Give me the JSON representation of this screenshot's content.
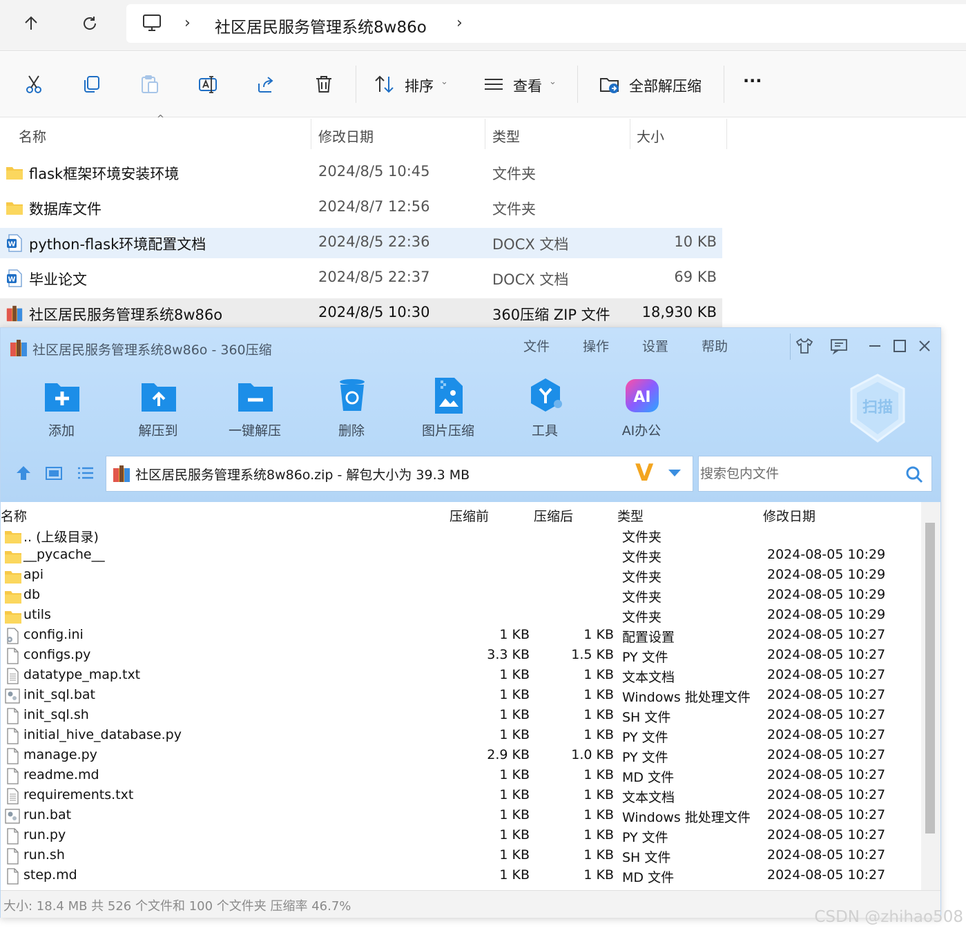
{
  "explorer": {
    "breadcrumb": {
      "current": "社区居民服务管理系统8w86o",
      "sep": "›"
    },
    "toolbar": {
      "sort_label": "排序",
      "view_label": "查看",
      "extract_all_label": "全部解压缩",
      "more_label": "···"
    },
    "columns": {
      "name": "名称",
      "date": "修改日期",
      "type": "类型",
      "size": "大小"
    },
    "rows": [
      {
        "name": "flask框架环境安装环境",
        "date": "2024/8/5 10:45",
        "type": "文件夹",
        "size": "",
        "icon": "folder-icon"
      },
      {
        "name": "数据库文件",
        "date": "2024/8/7 12:56",
        "type": "文件夹",
        "size": "",
        "icon": "folder-icon"
      },
      {
        "name": "python-flask环境配置文档",
        "date": "2024/8/5 22:36",
        "type": "DOCX 文档",
        "size": "10 KB",
        "icon": "word-doc-icon"
      },
      {
        "name": "毕业论文",
        "date": "2024/8/5 22:37",
        "type": "DOCX 文档",
        "size": "69 KB",
        "icon": "word-doc-icon"
      },
      {
        "name": "社区居民服务管理系统8w86o",
        "date": "2024/8/5 10:30",
        "type": "360压缩 ZIP 文件",
        "size": "18,930 KB",
        "icon": "zip-archive-icon"
      }
    ]
  },
  "zip": {
    "title": "社区居民服务管理系统8w86o - 360压缩",
    "menu": [
      "文件",
      "操作",
      "设置",
      "帮助"
    ],
    "toolbar": [
      {
        "label": "添加",
        "icon": "add-icon"
      },
      {
        "label": "解压到",
        "icon": "extract-to-icon"
      },
      {
        "label": "一键解压",
        "icon": "one-click-extract-icon"
      },
      {
        "label": "删除",
        "icon": "delete-icon"
      },
      {
        "label": "图片压缩",
        "icon": "image-compress-icon"
      },
      {
        "label": "工具",
        "icon": "tools-icon"
      },
      {
        "label": "AI办公",
        "icon": "ai-office-icon"
      }
    ],
    "scan_label": "扫描",
    "ai_badge": "AI",
    "path": "社区居民服务管理系统8w86o.zip - 解包大小为 39.3 MB",
    "v_badge": "V",
    "search_placeholder": "搜索包内文件",
    "columns": {
      "name": "名称",
      "before": "压缩前",
      "after": "压缩后",
      "type": "类型",
      "date": "修改日期"
    },
    "files": [
      {
        "name": ".. (上级目录)",
        "before": "",
        "after": "",
        "type": "文件夹",
        "date": "",
        "icon": "folder-icon"
      },
      {
        "name": "__pycache__",
        "before": "",
        "after": "",
        "type": "文件夹",
        "date": "2024-08-05 10:29",
        "icon": "folder-icon"
      },
      {
        "name": "api",
        "before": "",
        "after": "",
        "type": "文件夹",
        "date": "2024-08-05 10:29",
        "icon": "folder-icon"
      },
      {
        "name": "db",
        "before": "",
        "after": "",
        "type": "文件夹",
        "date": "2024-08-05 10:29",
        "icon": "folder-icon"
      },
      {
        "name": "utils",
        "before": "",
        "after": "",
        "type": "文件夹",
        "date": "2024-08-05 10:29",
        "icon": "folder-icon"
      },
      {
        "name": "config.ini",
        "before": "1 KB",
        "after": "1 KB",
        "type": "配置设置",
        "date": "2024-08-05 10:27",
        "icon": "settings-file-icon"
      },
      {
        "name": "configs.py",
        "before": "3.3 KB",
        "after": "1.5 KB",
        "type": "PY 文件",
        "date": "2024-08-05 10:27",
        "icon": "file-icon"
      },
      {
        "name": "datatype_map.txt",
        "before": "1 KB",
        "after": "1 KB",
        "type": "文本文档",
        "date": "2024-08-05 10:27",
        "icon": "text-file-icon"
      },
      {
        "name": "init_sql.bat",
        "before": "1 KB",
        "after": "1 KB",
        "type": "Windows 批处理文件",
        "date": "2024-08-05 10:27",
        "icon": "batch-file-icon"
      },
      {
        "name": "init_sql.sh",
        "before": "1 KB",
        "after": "1 KB",
        "type": "SH 文件",
        "date": "2024-08-05 10:27",
        "icon": "file-icon"
      },
      {
        "name": "initial_hive_database.py",
        "before": "1 KB",
        "after": "1 KB",
        "type": "PY 文件",
        "date": "2024-08-05 10:27",
        "icon": "file-icon"
      },
      {
        "name": "manage.py",
        "before": "2.9 KB",
        "after": "1.0 KB",
        "type": "PY 文件",
        "date": "2024-08-05 10:27",
        "icon": "file-icon"
      },
      {
        "name": "readme.md",
        "before": "1 KB",
        "after": "1 KB",
        "type": "MD 文件",
        "date": "2024-08-05 10:27",
        "icon": "file-icon"
      },
      {
        "name": "requirements.txt",
        "before": "1 KB",
        "after": "1 KB",
        "type": "文本文档",
        "date": "2024-08-05 10:27",
        "icon": "text-file-icon"
      },
      {
        "name": "run.bat",
        "before": "1 KB",
        "after": "1 KB",
        "type": "Windows 批处理文件",
        "date": "2024-08-05 10:27",
        "icon": "batch-file-icon"
      },
      {
        "name": "run.py",
        "before": "1 KB",
        "after": "1 KB",
        "type": "PY 文件",
        "date": "2024-08-05 10:27",
        "icon": "file-icon"
      },
      {
        "name": "run.sh",
        "before": "1 KB",
        "after": "1 KB",
        "type": "SH 文件",
        "date": "2024-08-05 10:27",
        "icon": "file-icon"
      },
      {
        "name": "step.md",
        "before": "1 KB",
        "after": "1 KB",
        "type": "MD 文件",
        "date": "2024-08-05 10:27",
        "icon": "file-icon"
      }
    ],
    "status": "大小: 18.4 MB 共 526 个文件和 100 个文件夹 压缩率 46.7%"
  },
  "watermark": "CSDN @zhihao508",
  "colors": {
    "accent": "#2b8de4",
    "zip_toolbar_bg": "#c4e0fb",
    "selection": "#e6f0fb",
    "folder": "#f7c948"
  }
}
